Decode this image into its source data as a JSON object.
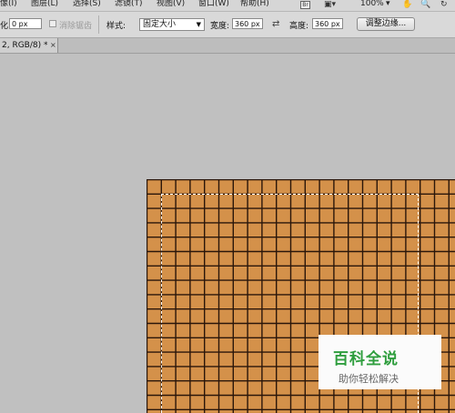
{
  "menu": {
    "items": [
      "像(I)",
      "图层(L)",
      "选择(S)",
      "滤镜(T)",
      "视图(V)",
      "窗口(W)",
      "帮助(H)"
    ],
    "br_icon": "bridge-icon",
    "screen_mode_icon": "screen-mode-icon",
    "zoom": "100%",
    "hand_icon": "hand-icon",
    "zoom_icon": "zoom-icon",
    "rotate_icon": "rotate-view-icon"
  },
  "options": {
    "feather_label": "化:",
    "feather_value": "0 px",
    "antialias_label": "消除锯齿",
    "style_label": "样式:",
    "style_value": "固定大小",
    "width_label": "宽度:",
    "width_value": "360 px",
    "height_label": "高度:",
    "height_value": "360 px",
    "refine_edge_button": "调整边缘..."
  },
  "document": {
    "tab_label": "2, RGB/8) *",
    "close_symbol": "×"
  },
  "colors": {
    "tile_fill": "#d4914a",
    "grid_line": "#2a160a"
  },
  "watermark": {
    "title": "百科全说",
    "subtitle": "助你轻松解决"
  }
}
